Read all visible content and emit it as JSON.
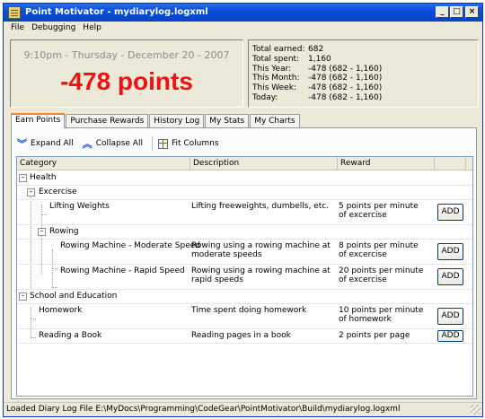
{
  "window": {
    "title": "Point Motivator - mydiarylog.logxml",
    "min": "_",
    "max": "□",
    "close": "×"
  },
  "menu": [
    "File",
    "Debugging",
    "Help"
  ],
  "header": {
    "date": "9:10pm - Thursday - December 20 - 2007",
    "points": "-478 points"
  },
  "stats": [
    {
      "label": "Total earned:",
      "value": "682"
    },
    {
      "label": "Total spent:",
      "value": "1,160"
    },
    {
      "label": "This Year:",
      "value": "-478 (682 - 1,160)"
    },
    {
      "label": "This Month:",
      "value": "-478 (682 - 1,160)"
    },
    {
      "label": "This Week:",
      "value": "-478 (682 - 1,160)"
    },
    {
      "label": "Today:",
      "value": "-478 (682 - 1,160)"
    }
  ],
  "tabs": [
    "Earn Points",
    "Purchase Rewards",
    "History Log",
    "My Stats",
    "My Charts"
  ],
  "toolbar": {
    "expand": "Expand All",
    "collapse": "Collapse All",
    "fit": "Fit Columns"
  },
  "columns": {
    "category": "Category",
    "description": "Description",
    "reward": "Reward"
  },
  "rows": [
    {
      "category": "Health",
      "description": "",
      "reward": "",
      "add": ""
    },
    {
      "category": "Excercise",
      "description": "",
      "reward": "",
      "add": ""
    },
    {
      "category": "Lifting Weights",
      "description": "Lifting freeweights, dumbells, etc.",
      "reward": "5 points per minute of excercise",
      "add": "ADD"
    },
    {
      "category": "Rowing",
      "description": "",
      "reward": "",
      "add": ""
    },
    {
      "category": "Rowing Machine - Moderate Speed",
      "description": "Rowing using a rowing machine at moderate speeds",
      "reward": "8 points per minute of excercise",
      "add": "ADD"
    },
    {
      "category": "Rowing Machine - Rapid Speed",
      "description": "Rowing using a rowing machine at rapid speeds",
      "reward": "20 points per minute of excercise",
      "add": "ADD"
    },
    {
      "category": "School and Education",
      "description": "",
      "reward": "",
      "add": ""
    },
    {
      "category": "Homework",
      "description": "Time spent doing homework",
      "reward": "10 points per minute of homework",
      "add": "ADD"
    },
    {
      "category": "Reading a Book",
      "description": "Reading pages in a book",
      "reward": "2 points per page",
      "add": "ADD"
    }
  ],
  "status": "Loaded Diary Log File E:\\MyDocs\\Programming\\CodeGear\\PointMotivator\\Build\\mydiarylog.logxml"
}
